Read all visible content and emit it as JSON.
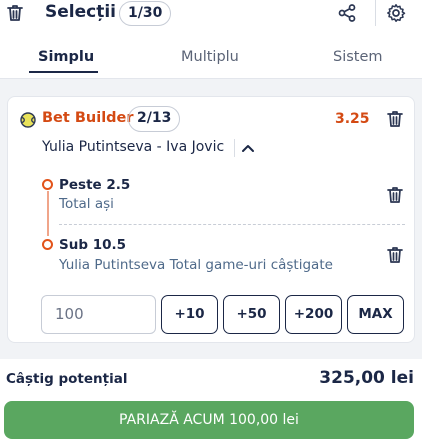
{
  "header": {
    "title": "Selecții",
    "count": "1/30",
    "icons": {
      "delete": "trash-icon",
      "share": "share-icon",
      "settings": "gear-icon"
    }
  },
  "tabs": [
    {
      "label": "Simplu",
      "active": true
    },
    {
      "label": "Multiplu",
      "active": false
    },
    {
      "label": "Sistem",
      "active": false
    }
  ],
  "bet_builder": {
    "title": "Bet Builder",
    "count": "2/13",
    "odds": "3.25",
    "match": "Yulia Putintseva - Iva Jovic",
    "selections": [
      {
        "title": "Peste 2.5",
        "subtitle": "Total ași"
      },
      {
        "title": "Sub 10.5",
        "subtitle": "Yulia Putintseva Total game-uri câștigate"
      }
    ]
  },
  "stake": {
    "value": "100",
    "quick_buttons": [
      "+10",
      "+50",
      "+200",
      "MAX"
    ]
  },
  "potential_win": {
    "label": "Câștig potențial",
    "value": "325,00 lei"
  },
  "bet_button": {
    "label": "PARIAZĂ ACUM 100,00 lei"
  },
  "colors": {
    "accent_orange": "#d44a13",
    "primary_dark": "#1b2746",
    "bet_green": "#5aa760"
  }
}
